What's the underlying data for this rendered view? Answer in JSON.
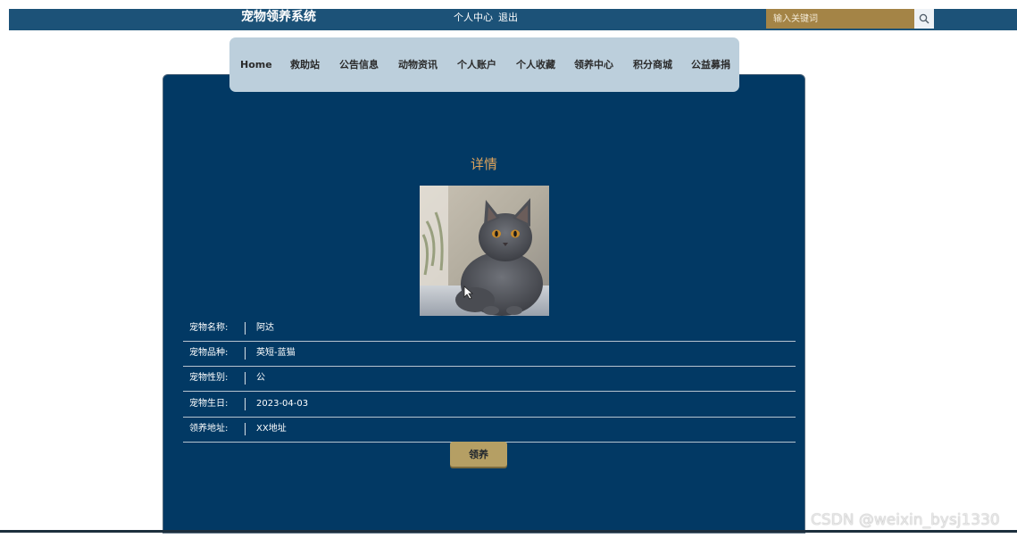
{
  "header": {
    "site_title": "宠物领养系统",
    "user_center": "个人中心",
    "logout": "退出",
    "search_placeholder": "输入关键词",
    "search_icon": "search-icon",
    "bar_color": "#1c5278",
    "search_color": "#a48446"
  },
  "nav": {
    "items": [
      {
        "label": "Home"
      },
      {
        "label": "救助站"
      },
      {
        "label": "公告信息"
      },
      {
        "label": "动物资讯"
      },
      {
        "label": "个人账户"
      },
      {
        "label": "个人收藏"
      },
      {
        "label": "领养中心"
      },
      {
        "label": "积分商城"
      },
      {
        "label": "公益募捐"
      }
    ]
  },
  "detail": {
    "title": "详情",
    "fields": [
      {
        "label": "宠物名称:",
        "value": "阿达"
      },
      {
        "label": "宠物品种:",
        "value": "英短-蓝猫"
      },
      {
        "label": "宠物性别:",
        "value": "公"
      },
      {
        "label": "宠物生日:",
        "value": "2023-04-03"
      },
      {
        "label": "领养地址:",
        "value": "XX地址"
      }
    ],
    "adopt_button": "领养"
  },
  "watermark": "CSDN @weixin_bysj1330",
  "colors": {
    "panel": "#023964",
    "nav": "#bccfdc",
    "title_accent": "#e0a45c",
    "adopt_button": "#b59f64"
  }
}
